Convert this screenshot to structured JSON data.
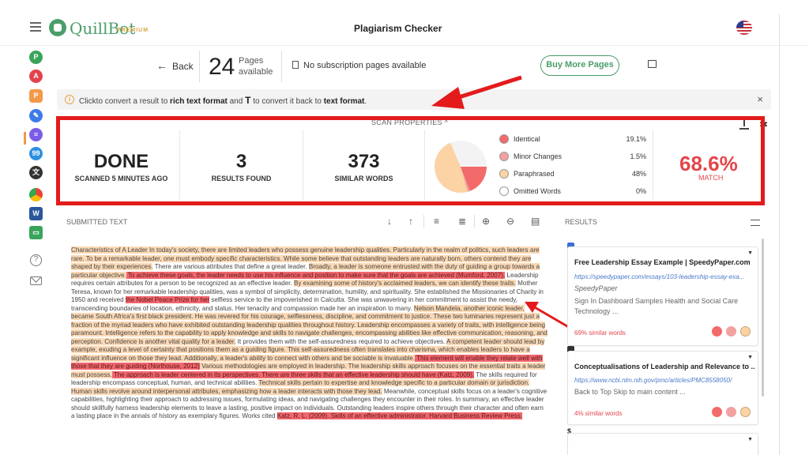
{
  "app": {
    "brand": "QuillBot",
    "tier": "PREMIUM",
    "page_title": "Plagiarism Checker"
  },
  "sidebar": {
    "icons": [
      "paraphraser-icon",
      "grammar-icon",
      "plagiarism-icon",
      "cowriter-icon",
      "summarizer-icon",
      "citation-icon",
      "translator-icon",
      "chrome-extension-icon",
      "word-addin-icon",
      "desktop-icon",
      "help-icon",
      "mail-icon"
    ]
  },
  "header": {
    "back_label": "Back",
    "pages_count": "24",
    "pages_label": "Pages available",
    "subscription_note": "No subscription pages available",
    "buy_button": "Buy More Pages"
  },
  "banner": {
    "text_prefix": "Clickto convert a result to ",
    "bold1": "rich text format",
    "text_mid": " and ",
    "glyph": "T",
    "text_mid2": " to convert it back to ",
    "bold2": "text format",
    "text_end": ".",
    "close": "×"
  },
  "scan": {
    "header": "SCAN PROPERTIES ^",
    "status": "DONE",
    "status_label": "SCANNED 5 MINUTES AGO",
    "results_count": "3",
    "results_label": "RESULTS FOUND",
    "similar_words": "373",
    "similar_label": "SIMILAR WORDS",
    "match": "68.6%",
    "match_label": "MATCH"
  },
  "chart_data": {
    "type": "pie",
    "categories": [
      "Identical",
      "Minor Changes",
      "Paraphrased",
      "Omitted Words"
    ],
    "values": [
      19.1,
      1.5,
      48,
      0
    ],
    "labels": [
      "19.1%",
      "1.5%",
      "48%",
      "0%"
    ],
    "colors": [
      "#f26a6a",
      "#f2a0a0",
      "#fbd3a5",
      "#ffffff"
    ],
    "remainder_color": "#f3f3f3"
  },
  "submitted": {
    "header": "SUBMITTED TEXT",
    "segments": [
      {
        "t": "Characteristics of A Leader In today's society, there are limited leaders who possess genuine leadership qualities. Particularly in the realm of politics, such leaders are rare. To be a remarkable leader, one must embody specific characteristics. While some believe that outstanding leaders are naturally born, others contend they are shaped by their experiences.",
        "c": "y"
      },
      {
        "t": " There are various attributes that define a great leader. ",
        "c": ""
      },
      {
        "t": "Broadly, a leader is someone entrusted with the duty of guiding a group towards a particular objective.",
        "c": "y"
      },
      {
        "t": " To achieve these goals, the leader needs to use his influence and position to make sure that the goals are achieved (Mumford, 2007).",
        "c": "r"
      },
      {
        "t": " Leadership requires certain attributes for a person to be recognized as an effective leader. ",
        "c": ""
      },
      {
        "t": "By examining some of history's acclaimed leaders, we can identify these traits.",
        "c": "y"
      },
      {
        "t": " Mother Teresa, known for her remarkable leadership qualities, was a symbol of simplicity, determination, humility, and spirituality. She established the Missionaries of Charity in 1950 and received ",
        "c": ""
      },
      {
        "t": "the Nobel Peace Prize for her",
        "c": "r"
      },
      {
        "t": " selfless service to the impoverished in Calcutta. She was unwavering in her commitment to assist the needy, transcending boundaries of location, ethnicity, and status. Her tenacity and compassion made her an inspiration to many. ",
        "c": ""
      },
      {
        "t": "Nelson Mandela, another iconic leader, became South Africa's first black president. He was revered for his courage, selflessness, discipline, and commitment to justice. These two luminaries represent just a fraction of the myriad leaders who have exhibited outstanding leadership qualities throughout history. Leadership encompasses a variety of traits, with intelligence being paramount. Intelligence refers to the capability to apply knowledge and skills to navigate challenges, encompassing abilities like effective communication, reasoning, and perception. Confidence is another vital quality for a leader.",
        "c": "y"
      },
      {
        "t": " It provides them with the self-assuredness required to achieve objectives. ",
        "c": ""
      },
      {
        "t": "A competent leader should lead by example, exuding a level of certainty that positions them as a guiding figure. This self-assuredness often translates into charisma, which enables leaders to have a significant influence on those they lead. Additionally, a leader's ability to connect with others and be sociable is invaluable.",
        "c": "y"
      },
      {
        "t": " This element will enable they relate well with those that they are guiding (Northouse, 2012)",
        "c": "r"
      },
      {
        "t": " Various methodologies are employed in leadership. The leadership skills approach focuses on the essential traits a leader must possess.",
        "c": "y"
      },
      {
        "t": " The approach is leader centered in its perspectives. There are three skills that an effective leadership should have (Katz, 2009).",
        "c": "r"
      },
      {
        "t": " The skills required for leadership encompass conceptual, human, and technical abilities. ",
        "c": ""
      },
      {
        "t": "Technical skills pertain to expertise and knowledge specific to a particular domain or jurisdiction. Human skills revolve around interpersonal attributes, emphasizing how a leader interacts with those they lead.",
        "c": "y"
      },
      {
        "t": " Meanwhile, conceptual skills focus on a leader's cognitive capabilities, highlighting their approach to addressing issues, formulating ideas, and navigating challenges they encounter in their roles. In summary, an effective leader should skillfully harness leadership elements to leave a lasting, positive impact on individuals. Outstanding leaders inspire others through their character and often earn a lasting place in the annals of history as exemplary figures. Works cited ",
        "c": ""
      },
      {
        "t": "Katz, R. L. (2009). Skills of an effective administrator. Harvard Business Review Press.",
        "c": "r"
      }
    ]
  },
  "results": {
    "header": "RESULTS",
    "items": [
      {
        "title": "Free Leadership Essay Example | SpeedyPaper.com",
        "url": "https://speedypaper.com/essays/103-leadership-essay-exa...",
        "source": "SpeedyPaper",
        "snippet": "Sign In Dashboard Samples Health and Social Care Technology ...",
        "similar": "69% similar words"
      },
      {
        "title": "Conceptualisations of Leadership and Relevance to ...",
        "url": "https://www.ncbi.nlm.nih.gov/pmc/articles/PMC8558050/",
        "source": "",
        "snippet": "Back to Top Skip to main content ...",
        "similar": "4% similar words"
      },
      {
        "title": "",
        "url": "",
        "source": "",
        "snippet": "",
        "similar": ""
      }
    ]
  }
}
